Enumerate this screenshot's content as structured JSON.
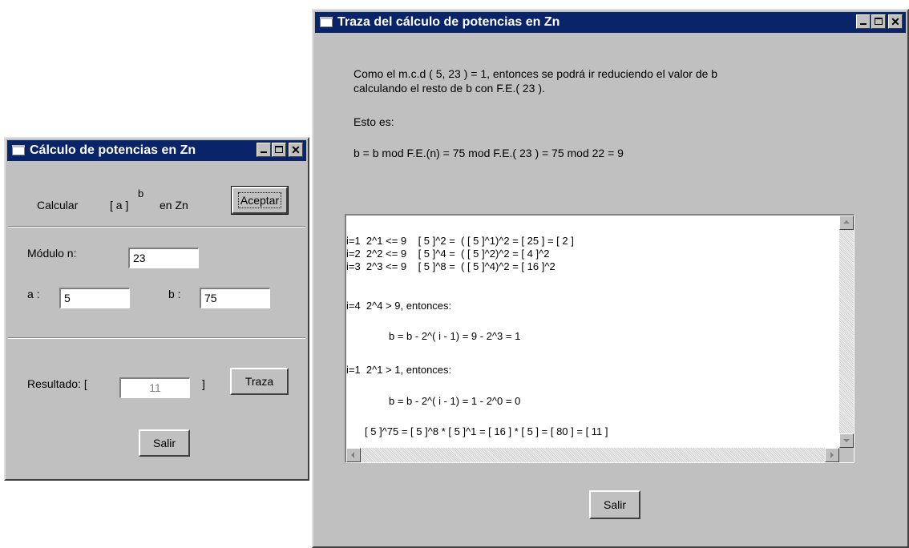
{
  "left_window": {
    "title": "Cálculo de potencias en Zn",
    "calc_label": "Calcular",
    "formula_a": "[ a ]",
    "formula_exp": "b",
    "formula_zn": "en  Zn",
    "accept_button": "Aceptar",
    "modulo_label": "Módulo  n:",
    "modulo_value": "23",
    "a_label": "a :",
    "a_value": "5",
    "b_label": "b :",
    "b_value": "75",
    "result_label": "Resultado: [",
    "result_value": "11",
    "result_close": "]",
    "trace_button": "Traza",
    "exit_button": "Salir"
  },
  "right_window": {
    "title": "Traza del cálculo de potencias en Zn",
    "intro_line1": "Como el m.c.d ( 5, 23 ) = 1, entonces se podrá ir reduciendo el valor de b",
    "intro_line2": "calculando el resto de b con F.E.( 23 ).",
    "esto_es": "Esto es:",
    "formula": "b = b mod F.E.(n) = 75 mod F.E.( 23 ) = 75 mod 22 = 9",
    "trace_lines": [
      "i=1  2^1 <= 9    [ 5 ]^2 =  ( [ 5 ]^1)^2 = [ 25 ] = [ 2 ]",
      "i=2  2^2 <= 9    [ 5 ]^4 =  ( [ 5 ]^2)^2 = [ 4 ]^2",
      "i=3  2^3 <= 9    [ 5 ]^8 =  ( [ 5 ]^4)^2 = [ 16 ]^2",
      "i=4  2^4 > 9, entonces:",
      "b = b - 2^( i - 1) = 9 - 2^3 = 1",
      "i=1  2^1 > 1, entonces:",
      "b = b - 2^( i - 1) = 1 - 2^0 = 0",
      "[ 5 ]^75 = [ 5 ]^8 * [ 5 ]^1 = [ 16 ] * [ 5 ] = [ 80 ] = [ 11 ]"
    ],
    "exit_button": "Salir"
  }
}
